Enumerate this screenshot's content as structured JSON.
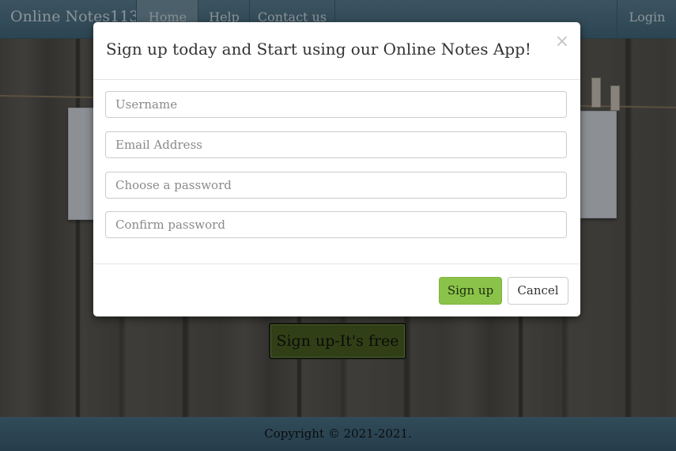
{
  "navbar": {
    "brand": "Online Notes113",
    "items": [
      {
        "label": "Home"
      },
      {
        "label": "Help"
      },
      {
        "label": "Contact us"
      }
    ],
    "login_label": "Login"
  },
  "background": {
    "cta_label": "Sign up-It's free"
  },
  "footer": {
    "copyright": "Copyright © 2021-2021."
  },
  "modal": {
    "title": "Sign up today and Start using our Online Notes App!",
    "close_glyph": "×",
    "fields": {
      "username_placeholder": "Username",
      "email_placeholder": "Email Address",
      "password_placeholder": "Choose a password",
      "confirm_placeholder": "Confirm password"
    },
    "signup_label": "Sign up",
    "cancel_label": "Cancel"
  },
  "colors": {
    "navbar": "#4f7589",
    "signup_button": "#8bc34a",
    "cta_button": "#4c6222"
  }
}
